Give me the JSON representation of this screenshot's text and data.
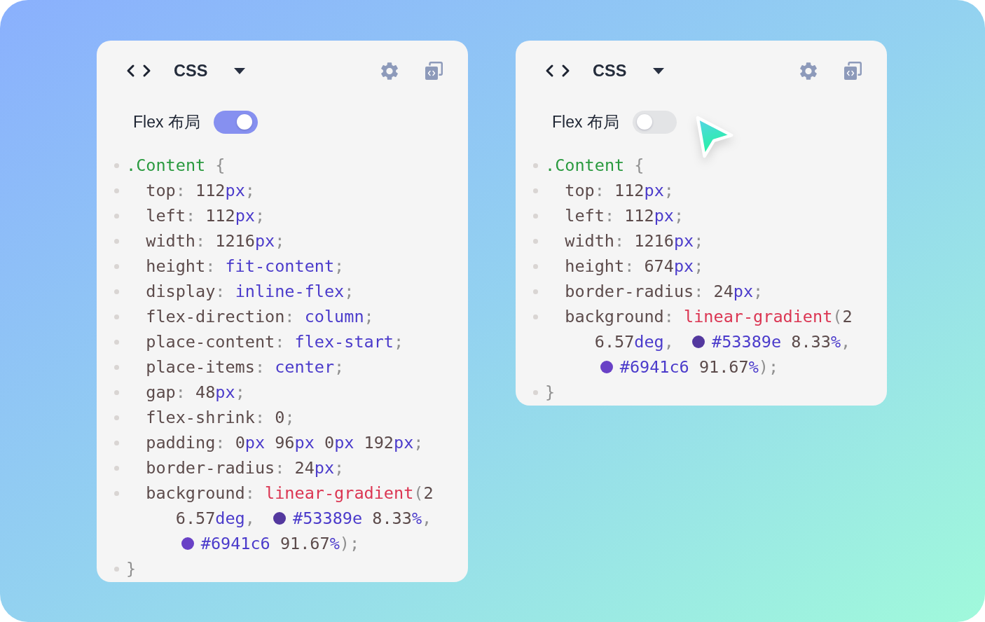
{
  "panels": [
    {
      "language": "CSS",
      "toggle": {
        "label": "Flex 布局",
        "on": true
      },
      "cursor": false,
      "code": [
        {
          "kind": "selector",
          "tokens": [
            {
              "kind": "selector",
              "text": ".Content"
            },
            {
              "kind": "punct",
              "text": " {"
            }
          ]
        },
        {
          "kind": "declaration",
          "tokens": [
            {
              "kind": "prop",
              "text": "top"
            },
            {
              "kind": "punct",
              "text": ": "
            },
            {
              "kind": "number",
              "text": "112"
            },
            {
              "kind": "unit",
              "text": "px"
            },
            {
              "kind": "punct",
              "text": ";"
            }
          ]
        },
        {
          "kind": "declaration",
          "tokens": [
            {
              "kind": "prop",
              "text": "left"
            },
            {
              "kind": "punct",
              "text": ": "
            },
            {
              "kind": "number",
              "text": "112"
            },
            {
              "kind": "unit",
              "text": "px"
            },
            {
              "kind": "punct",
              "text": ";"
            }
          ]
        },
        {
          "kind": "declaration",
          "tokens": [
            {
              "kind": "prop",
              "text": "width"
            },
            {
              "kind": "punct",
              "text": ": "
            },
            {
              "kind": "number",
              "text": "1216"
            },
            {
              "kind": "unit",
              "text": "px"
            },
            {
              "kind": "punct",
              "text": ";"
            }
          ]
        },
        {
          "kind": "declaration",
          "tokens": [
            {
              "kind": "prop",
              "text": "height"
            },
            {
              "kind": "punct",
              "text": ": "
            },
            {
              "kind": "keyword",
              "text": "fit-content"
            },
            {
              "kind": "punct",
              "text": ";"
            }
          ]
        },
        {
          "kind": "declaration",
          "tokens": [
            {
              "kind": "prop",
              "text": "display"
            },
            {
              "kind": "punct",
              "text": ": "
            },
            {
              "kind": "keyword",
              "text": "inline-flex"
            },
            {
              "kind": "punct",
              "text": ";"
            }
          ]
        },
        {
          "kind": "declaration",
          "tokens": [
            {
              "kind": "prop",
              "text": "flex-direction"
            },
            {
              "kind": "punct",
              "text": ": "
            },
            {
              "kind": "keyword",
              "text": "column"
            },
            {
              "kind": "punct",
              "text": ";"
            }
          ]
        },
        {
          "kind": "declaration",
          "tokens": [
            {
              "kind": "prop",
              "text": "place-content"
            },
            {
              "kind": "punct",
              "text": ": "
            },
            {
              "kind": "keyword",
              "text": "flex-start"
            },
            {
              "kind": "punct",
              "text": ";"
            }
          ]
        },
        {
          "kind": "declaration",
          "tokens": [
            {
              "kind": "prop",
              "text": "place-items"
            },
            {
              "kind": "punct",
              "text": ": "
            },
            {
              "kind": "keyword",
              "text": "center"
            },
            {
              "kind": "punct",
              "text": ";"
            }
          ]
        },
        {
          "kind": "declaration",
          "tokens": [
            {
              "kind": "prop",
              "text": "gap"
            },
            {
              "kind": "punct",
              "text": ": "
            },
            {
              "kind": "number",
              "text": "48"
            },
            {
              "kind": "unit",
              "text": "px"
            },
            {
              "kind": "punct",
              "text": ";"
            }
          ]
        },
        {
          "kind": "declaration",
          "tokens": [
            {
              "kind": "prop",
              "text": "flex-shrink"
            },
            {
              "kind": "punct",
              "text": ": "
            },
            {
              "kind": "number",
              "text": "0"
            },
            {
              "kind": "punct",
              "text": ";"
            }
          ]
        },
        {
          "kind": "declaration",
          "tokens": [
            {
              "kind": "prop",
              "text": "padding"
            },
            {
              "kind": "punct",
              "text": ": "
            },
            {
              "kind": "number",
              "text": "0"
            },
            {
              "kind": "unit",
              "text": "px"
            },
            {
              "kind": "number",
              "text": " 96"
            },
            {
              "kind": "unit",
              "text": "px"
            },
            {
              "kind": "number",
              "text": " 0"
            },
            {
              "kind": "unit",
              "text": "px"
            },
            {
              "kind": "number",
              "text": " 192"
            },
            {
              "kind": "unit",
              "text": "px"
            },
            {
              "kind": "punct",
              "text": ";"
            }
          ]
        },
        {
          "kind": "declaration",
          "tokens": [
            {
              "kind": "prop",
              "text": "border-radius"
            },
            {
              "kind": "punct",
              "text": ": "
            },
            {
              "kind": "number",
              "text": "24"
            },
            {
              "kind": "unit",
              "text": "px"
            },
            {
              "kind": "punct",
              "text": ";"
            }
          ]
        },
        {
          "kind": "declaration",
          "tokens": [
            {
              "kind": "prop",
              "text": "background"
            },
            {
              "kind": "punct",
              "text": ": "
            },
            {
              "kind": "function",
              "text": "linear-gradient"
            },
            {
              "kind": "punct",
              "text": "("
            },
            {
              "kind": "number",
              "text": "2"
            },
            {
              "kind": "wrap"
            },
            {
              "kind": "number",
              "text": "6.57"
            },
            {
              "kind": "unit",
              "text": "deg"
            },
            {
              "kind": "punct",
              "text": ","
            },
            {
              "kind": "swatch",
              "color": "#53389e"
            },
            {
              "kind": "hex",
              "text": "#53389e"
            },
            {
              "kind": "number",
              "text": " 8.33"
            },
            {
              "kind": "unit",
              "text": "%"
            },
            {
              "kind": "punct",
              "text": ","
            },
            {
              "kind": "wrap"
            },
            {
              "kind": "swatch",
              "color": "#6941c6"
            },
            {
              "kind": "hex",
              "text": "#6941c6"
            },
            {
              "kind": "number",
              "text": " 91.67"
            },
            {
              "kind": "unit",
              "text": "%"
            },
            {
              "kind": "punct",
              "text": ");"
            }
          ]
        },
        {
          "kind": "close",
          "tokens": [
            {
              "kind": "punct",
              "text": "}"
            }
          ]
        }
      ]
    },
    {
      "language": "CSS",
      "toggle": {
        "label": "Flex 布局",
        "on": false
      },
      "cursor": true,
      "code": [
        {
          "kind": "selector",
          "tokens": [
            {
              "kind": "selector",
              "text": ".Content"
            },
            {
              "kind": "punct",
              "text": " {"
            }
          ]
        },
        {
          "kind": "declaration",
          "tokens": [
            {
              "kind": "prop",
              "text": "top"
            },
            {
              "kind": "punct",
              "text": ": "
            },
            {
              "kind": "number",
              "text": "112"
            },
            {
              "kind": "unit",
              "text": "px"
            },
            {
              "kind": "punct",
              "text": ";"
            }
          ]
        },
        {
          "kind": "declaration",
          "tokens": [
            {
              "kind": "prop",
              "text": "left"
            },
            {
              "kind": "punct",
              "text": ": "
            },
            {
              "kind": "number",
              "text": "112"
            },
            {
              "kind": "unit",
              "text": "px"
            },
            {
              "kind": "punct",
              "text": ";"
            }
          ]
        },
        {
          "kind": "declaration",
          "tokens": [
            {
              "kind": "prop",
              "text": "width"
            },
            {
              "kind": "punct",
              "text": ": "
            },
            {
              "kind": "number",
              "text": "1216"
            },
            {
              "kind": "unit",
              "text": "px"
            },
            {
              "kind": "punct",
              "text": ";"
            }
          ]
        },
        {
          "kind": "declaration",
          "tokens": [
            {
              "kind": "prop",
              "text": "height"
            },
            {
              "kind": "punct",
              "text": ": "
            },
            {
              "kind": "number",
              "text": "674"
            },
            {
              "kind": "unit",
              "text": "px"
            },
            {
              "kind": "punct",
              "text": ";"
            }
          ]
        },
        {
          "kind": "declaration",
          "tokens": [
            {
              "kind": "prop",
              "text": "border-radius"
            },
            {
              "kind": "punct",
              "text": ": "
            },
            {
              "kind": "number",
              "text": "24"
            },
            {
              "kind": "unit",
              "text": "px"
            },
            {
              "kind": "punct",
              "text": ";"
            }
          ]
        },
        {
          "kind": "declaration",
          "tokens": [
            {
              "kind": "prop",
              "text": "background"
            },
            {
              "kind": "punct",
              "text": ": "
            },
            {
              "kind": "function",
              "text": "linear-gradient"
            },
            {
              "kind": "punct",
              "text": "("
            },
            {
              "kind": "number",
              "text": "2"
            },
            {
              "kind": "wrap"
            },
            {
              "kind": "number",
              "text": "6.57"
            },
            {
              "kind": "unit",
              "text": "deg"
            },
            {
              "kind": "punct",
              "text": ","
            },
            {
              "kind": "swatch",
              "color": "#53389e"
            },
            {
              "kind": "hex",
              "text": "#53389e"
            },
            {
              "kind": "number",
              "text": " 8.33"
            },
            {
              "kind": "unit",
              "text": "%"
            },
            {
              "kind": "punct",
              "text": ","
            },
            {
              "kind": "wrap"
            },
            {
              "kind": "swatch",
              "color": "#6941c6"
            },
            {
              "kind": "hex",
              "text": "#6941c6"
            },
            {
              "kind": "number",
              "text": " 91.67"
            },
            {
              "kind": "unit",
              "text": "%"
            },
            {
              "kind": "punct",
              "text": ");"
            }
          ]
        },
        {
          "kind": "close",
          "tokens": [
            {
              "kind": "punct",
              "text": "}"
            }
          ]
        }
      ]
    }
  ]
}
